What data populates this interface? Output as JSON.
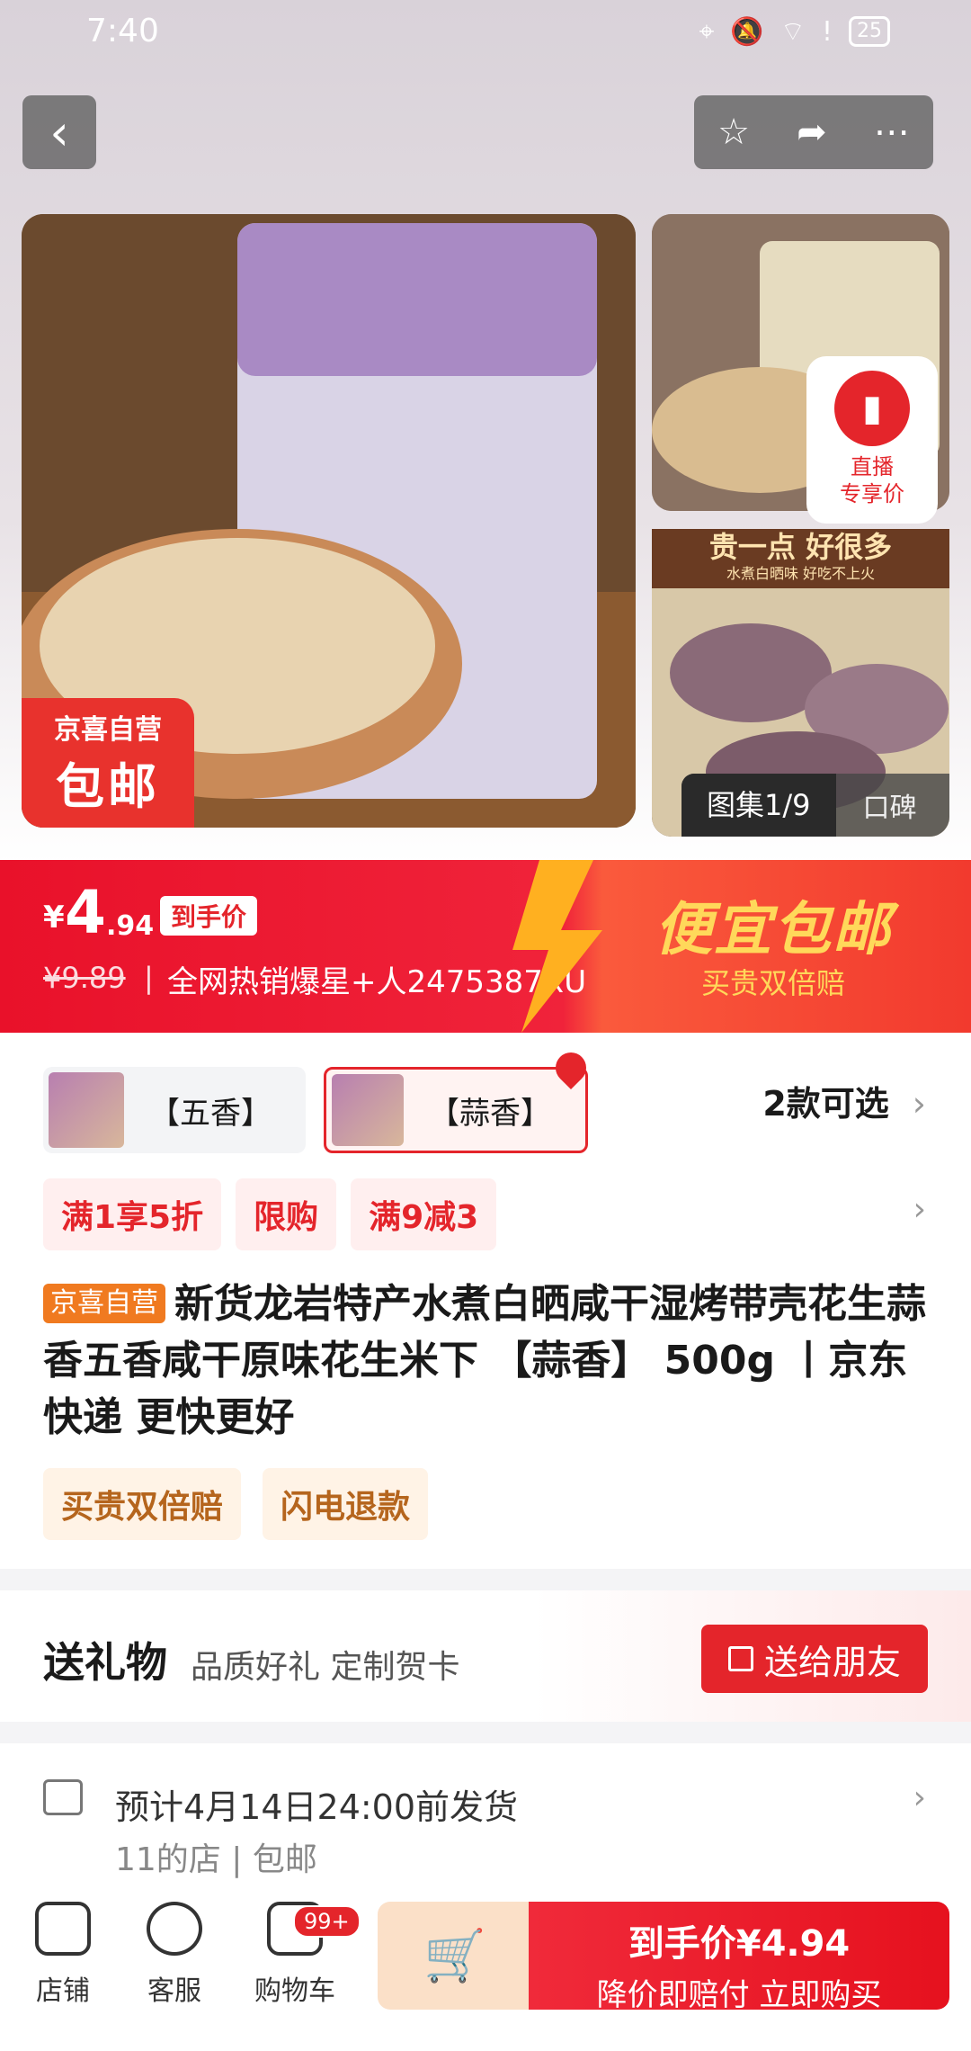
{
  "status": {
    "time": "7:40",
    "battery": "25"
  },
  "gallery": {
    "main_badge_top": "京喜自营",
    "main_badge_bottom": "包邮",
    "live_line1": "直播",
    "live_line2": "专享价",
    "banner_top": "贵一点 好很多",
    "banner_sub": "水煮白晒味 好吃不上火",
    "counter": "图集1/9",
    "koubei": "口碑"
  },
  "price": {
    "currency": "¥",
    "integer": "4",
    "decimal": ".94",
    "tag": "到手价",
    "original": "¥9.89",
    "separator": "|",
    "hot_text": "全网热销爆星+人2475387XU",
    "promo_title": "便宜包邮",
    "promo_sub": "买贵双倍赔"
  },
  "variants": {
    "items": [
      {
        "label": "【五香】"
      },
      {
        "label": "【蒜香】"
      }
    ],
    "count_text": "2款可选",
    "chevron": "›"
  },
  "coupons": [
    "满1享5折",
    "限购",
    "满9减3"
  ],
  "coupon_chevron": "›",
  "product": {
    "tag": "京喜自营",
    "title": "新货龙岩特产水煮白晒咸干湿烤带壳花生蒜香五香咸干原味花生米下 【蒜香】 500g 丨京东快递 更快更好"
  },
  "services": [
    "买贵双倍赔",
    "闪电退款"
  ],
  "gift": {
    "heading": "送礼物",
    "sub": "品质好礼 定制贺卡",
    "button": "送给朋友"
  },
  "shipping": {
    "line1": "预计4月14日24:00前发货",
    "line2": "11的店 | 包邮",
    "chevron": "›"
  },
  "bottom_bar": {
    "shop": "店铺",
    "service": "客服",
    "cart": "购物车",
    "cart_badge": "99+",
    "buy_line1": "到手价¥4.94",
    "buy_line2": "降价即赔付 立即购买"
  },
  "colors": {
    "accent": "#e4252b",
    "promo_yellow": "#ffd85a",
    "service_brown": "#b5651d"
  }
}
